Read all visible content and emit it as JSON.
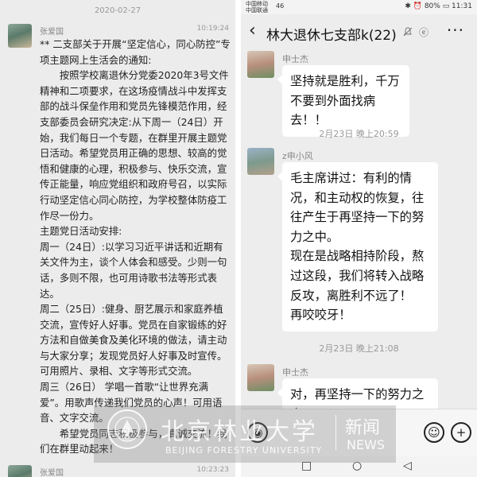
{
  "left": {
    "date": "2020-02-27",
    "sender": "张爱国",
    "time": "10:19:24",
    "paragraphs": [
      {
        "text": "** 二支部关于开展“坚定信心，同心防控”专项主题网上生活会的通知:",
        "indent": false
      },
      {
        "text": "按照学校离退休分党委2020年3号文件精神和二项要求，在这场疫情战斗中发挥支部的战斗保垒作用和党员先锋模范作用，经支部委员会研究决定:从下周一（24日）开始，我们每日一个专题，在群里开展主题党日活动。希望党员用正确的思想、较高的觉悟和健康的心理，积极参与、快乐交流，宣传正能量，响应党组织和政府号召，以实际行动坚定信心同心防控，为学校整体防疫工作尽一份力。",
        "indent": true
      },
      {
        "text": "主题党日活动安排:",
        "indent": false
      },
      {
        "text": "周一（24日）:以学习习近平讲话和近期有关文件为主，谈个人体会和感受。少则一句话，多则不限，也可用诗歌书法等形式表达。",
        "indent": false
      },
      {
        "text": "周二（25日）:健身、厨艺展示和家庭养植交流，宣传好人好事。党员在自家锻练的好方法和自做美食及美化环境的做法，请主动与大家分享；发现党员好人好事及时宣传。可用照片、录相、文字等形式交流。",
        "indent": false
      },
      {
        "text": "周三（26日） 学唱一首歌“让世界充满爱”。用歌声传递我们党员的心声！可用语音、文字交流。",
        "indent": false
      },
      {
        "text": "希望党员同志积极参与，真诚交流！我们在群里动起来！",
        "indent": true
      }
    ],
    "sender2": "张爱国",
    "time2": "10:23:23"
  },
  "right": {
    "status": {
      "carrier1": "中国移动",
      "carrier2": "中国联通",
      "signal": "46",
      "right": "✱ ⏰ 80% ▭ 11:31"
    },
    "title": "林大退休七支部k(22)",
    "messages": [
      {
        "sender": "申士杰",
        "avatar": "shi",
        "paragraphs": [
          "坚持就是胜利，千万不要到外面找病去！！"
        ]
      },
      {
        "time": "2月23日 晚上20:59"
      },
      {
        "sender": "z申小风",
        "avatar": "z",
        "paragraphs": [
          "毛主席讲过：有利的情况，和主动权的恢复，往往产生于再坚持一下的努力之中。",
          "现在是战略相持阶段，熬过这段，我们将转入战略反攻，离胜利不远了！",
          "再咬咬牙！"
        ]
      },
      {
        "time": "2月23日 晚上21:08"
      },
      {
        "sender": "申士杰",
        "avatar": "shi",
        "paragraphs": [
          "对，再坚持一下的努力之中！"
        ]
      }
    ]
  },
  "watermark": {
    "cn": "北京林业大学",
    "en": "BEIJING FORESTRY UNIVERSITY",
    "news_cn": "新闻",
    "news_en": "NEWS",
    "seal_text": "北京林业大学",
    "seal_year": "1952"
  }
}
